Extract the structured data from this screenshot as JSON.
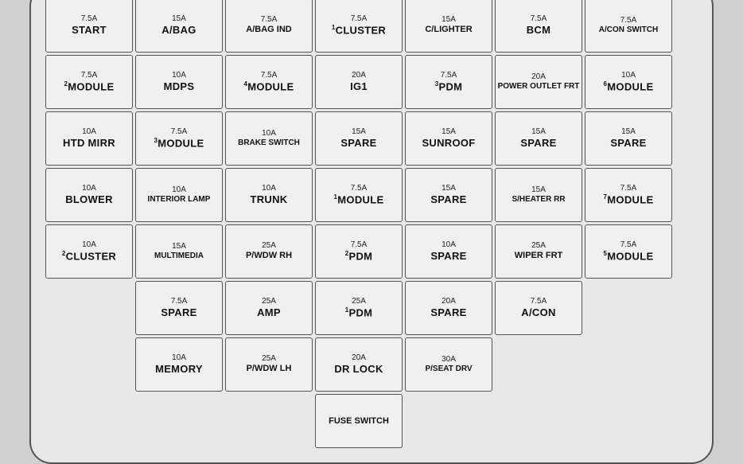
{
  "fuseBox": {
    "rows": [
      [
        {
          "amp": "7.5A",
          "label": "START",
          "size": "normal"
        },
        {
          "amp": "15A",
          "label": "A/BAG",
          "size": "normal"
        },
        {
          "amp": "7.5A",
          "label": "A/BAG IND",
          "size": "small",
          "sup": ""
        },
        {
          "amp": "7.5A",
          "label": "CLUSTER",
          "size": "normal",
          "sup": "1"
        },
        {
          "amp": "15A",
          "label": "C/LIGHTER",
          "size": "small"
        },
        {
          "amp": "7.5A",
          "label": "BCM",
          "size": "normal"
        },
        {
          "amp": "7.5A",
          "label": "A/CON SWITCH",
          "size": "xs"
        }
      ],
      [
        {
          "amp": "7.5A",
          "label": "MODULE",
          "size": "normal",
          "sup": "2"
        },
        {
          "amp": "10A",
          "label": "MDPS",
          "size": "normal"
        },
        {
          "amp": "7.5A",
          "label": "MODULE",
          "size": "normal",
          "sup": "4"
        },
        {
          "amp": "20A",
          "label": "IG1",
          "size": "normal"
        },
        {
          "amp": "7.5A",
          "label": "PDM",
          "size": "normal",
          "sup": "3"
        },
        {
          "amp": "20A",
          "label": "POWER OUTLET FRT",
          "size": "xs"
        },
        {
          "amp": "10A",
          "label": "MODULE",
          "size": "normal",
          "sup": "6"
        }
      ],
      [
        {
          "amp": "10A",
          "label": "HTD MIRR",
          "size": "normal"
        },
        {
          "amp": "7.5A",
          "label": "MODULE",
          "size": "normal",
          "sup": "3"
        },
        {
          "amp": "10A",
          "label": "BRAKE SWITCH",
          "size": "xs"
        },
        {
          "amp": "15A",
          "label": "SPARE",
          "size": "normal"
        },
        {
          "amp": "15A",
          "label": "SUNROOF",
          "size": "normal"
        },
        {
          "amp": "15A",
          "label": "SPARE",
          "size": "normal"
        },
        {
          "amp": "15A",
          "label": "SPARE",
          "size": "normal"
        }
      ],
      [
        {
          "amp": "10A",
          "label": "BLOWER",
          "size": "normal"
        },
        {
          "amp": "10A",
          "label": "INTERIOR LAMP",
          "size": "xs"
        },
        {
          "amp": "10A",
          "label": "TRUNK",
          "size": "normal"
        },
        {
          "amp": "7.5A",
          "label": "MODULE",
          "size": "normal",
          "sup": "1"
        },
        {
          "amp": "15A",
          "label": "SPARE",
          "size": "normal"
        },
        {
          "amp": "15A",
          "label": "S/HEATER RR",
          "size": "xs"
        },
        {
          "amp": "7.5A",
          "label": "MODULE",
          "size": "normal",
          "sup": "7"
        }
      ],
      [
        {
          "amp": "10A",
          "label": "CLUSTER",
          "size": "normal",
          "sup": "2"
        },
        {
          "amp": "15A",
          "label": "MULTIMEDIA",
          "size": "xs"
        },
        {
          "amp": "25A",
          "label": "P/WDW RH",
          "size": "small"
        },
        {
          "amp": "7.5A",
          "label": "PDM",
          "size": "normal",
          "sup": "2"
        },
        {
          "amp": "10A",
          "label": "SPARE",
          "size": "normal"
        },
        {
          "amp": "25A",
          "label": "WIPER FRT",
          "size": "small"
        },
        {
          "amp": "7.5A",
          "label": "MODULE",
          "size": "normal",
          "sup": "5"
        }
      ],
      [
        {
          "amp": "7.5A",
          "label": "SPARE",
          "size": "normal",
          "indent": 1
        },
        {
          "amp": "25A",
          "label": "AMP",
          "size": "normal"
        },
        {
          "amp": "25A",
          "label": "PDM",
          "size": "normal",
          "sup": "1"
        },
        {
          "amp": "20A",
          "label": "SPARE",
          "size": "normal"
        },
        {
          "amp": "7.5A",
          "label": "A/CON",
          "size": "normal"
        }
      ],
      [
        {
          "amp": "10A",
          "label": "MEMORY",
          "size": "normal",
          "indent": 1
        },
        {
          "amp": "25A",
          "label": "P/WDW LH",
          "size": "small"
        },
        {
          "amp": "20A",
          "label": "DR LOCK",
          "size": "normal"
        },
        {
          "amp": "30A",
          "label": "P/SEAT DRV",
          "size": "xs"
        }
      ],
      [
        {
          "amp": "",
          "label": "FUSE SWITCH",
          "size": "small",
          "indent": 3,
          "special": true
        }
      ]
    ]
  }
}
